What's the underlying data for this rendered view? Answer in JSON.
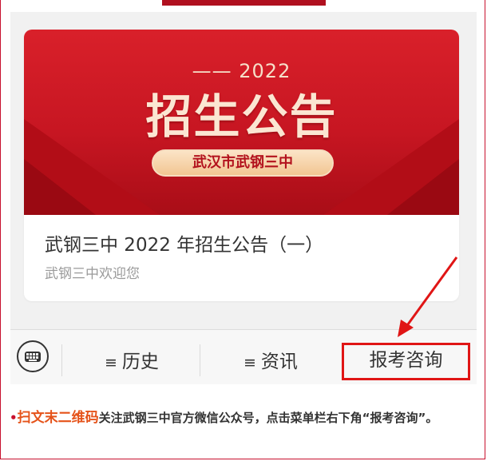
{
  "banner": {
    "year": "—— 2022",
    "title": "招生公告",
    "school": "武汉市武钢三中"
  },
  "article": {
    "title": "武钢三中 2022 年招生公告（一）",
    "subtitle": "武钢三中欢迎您"
  },
  "menu": {
    "keyboard_icon": "keyboard-icon",
    "items": [
      {
        "glyph": "≡",
        "label": "历史"
      },
      {
        "glyph": "≡",
        "label": "资讯"
      },
      {
        "glyph": "",
        "label": "报考咨询"
      }
    ]
  },
  "note": {
    "bullet": "•",
    "emphasis": "扫文末二维码",
    "text": "关注武钢三中官方微信公众号，点击菜单栏右下角“报考咨询”。"
  },
  "colors": {
    "brand_red": "#c8102e",
    "highlight": "#e01515",
    "emphasis": "#e5531a"
  }
}
